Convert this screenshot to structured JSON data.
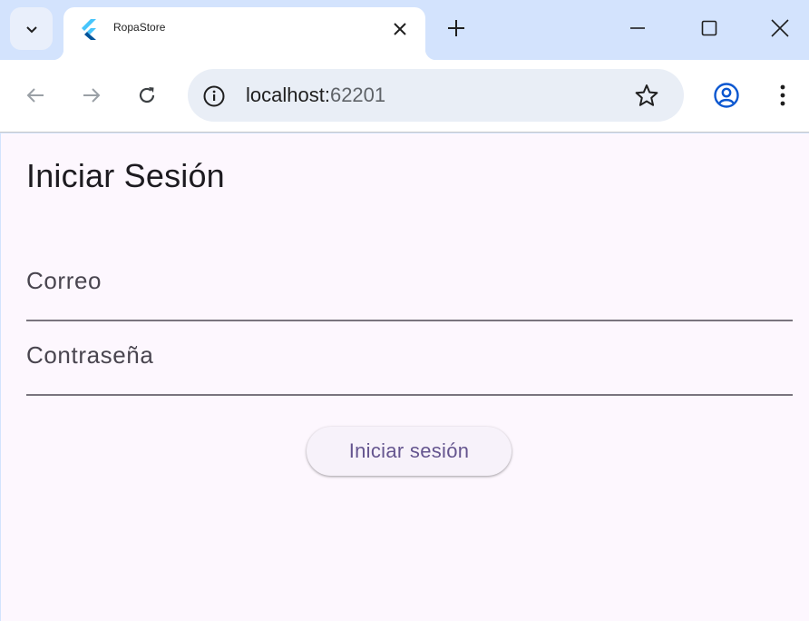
{
  "browser": {
    "tab": {
      "title": "RopaStore",
      "favicon": "flutter-icon"
    },
    "address": {
      "host": "localhost:",
      "port": "62201"
    },
    "icons": {
      "tab_search": "chevron-down-icon",
      "tab_close": "close-icon",
      "new_tab": "plus-icon",
      "minimize": "minimize-icon",
      "maximize": "maximize-icon",
      "close_window": "close-icon",
      "back": "arrow-left-icon",
      "forward": "arrow-right-icon",
      "reload": "reload-icon",
      "site_info": "info-icon",
      "bookmark": "star-icon",
      "profile": "account-icon",
      "menu": "more-vert-icon"
    },
    "colors": {
      "tabstrip": "#d3e3fd",
      "omnibox": "#e9eef6",
      "profile": "#0b57d0"
    }
  },
  "login": {
    "title": "Iniciar Sesión",
    "email_label": "Correo",
    "password_label": "Contraseña",
    "submit_label": "Iniciar sesión"
  },
  "theme": {
    "background": "#fdf7fe",
    "button_text": "#65558f",
    "underline": "#79747e"
  }
}
